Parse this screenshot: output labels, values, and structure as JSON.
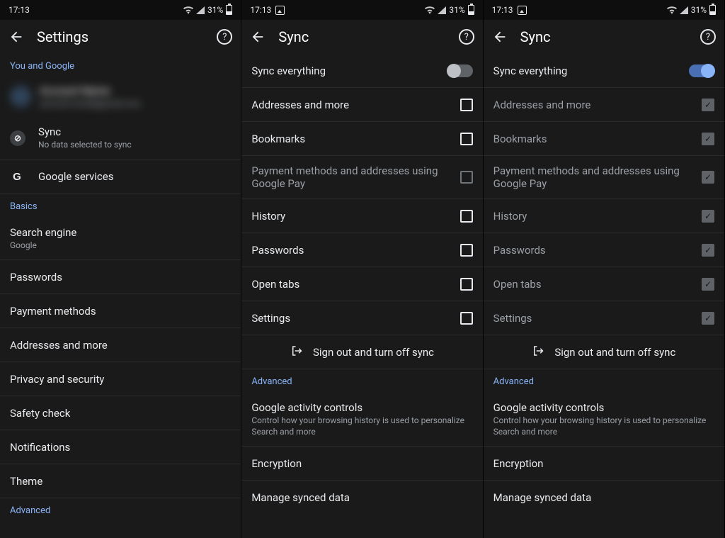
{
  "status": {
    "time": "17:13",
    "battery_pct": "31%"
  },
  "panel1": {
    "title": "Settings",
    "section_top": "You and Google",
    "account": {
      "name": "Account Name",
      "email": "account.email@gmail.com"
    },
    "sync": {
      "title": "Sync",
      "sub": "No data selected to sync"
    },
    "google_services": "Google services",
    "section_basics": "Basics",
    "search_engine": {
      "title": "Search engine",
      "sub": "Google"
    },
    "rows": {
      "passwords": "Passwords",
      "payment_methods": "Payment methods",
      "addresses": "Addresses and more",
      "privacy": "Privacy and security",
      "safety": "Safety check",
      "notifications": "Notifications",
      "theme": "Theme"
    },
    "section_advanced": "Advanced"
  },
  "sync_panel": {
    "title": "Sync",
    "sync_everything": "Sync everything",
    "items": {
      "addresses": "Addresses and more",
      "bookmarks": "Bookmarks",
      "gpay": "Payment methods and addresses using Google Pay",
      "history": "History",
      "passwords": "Passwords",
      "open_tabs": "Open tabs",
      "settings": "Settings"
    },
    "sign_out": "Sign out and turn off sync",
    "section_advanced": "Advanced",
    "activity": {
      "title": "Google activity controls",
      "sub": "Control how your browsing history is used to personalize Search and more"
    },
    "encryption": "Encryption",
    "manage": "Manage synced data"
  }
}
